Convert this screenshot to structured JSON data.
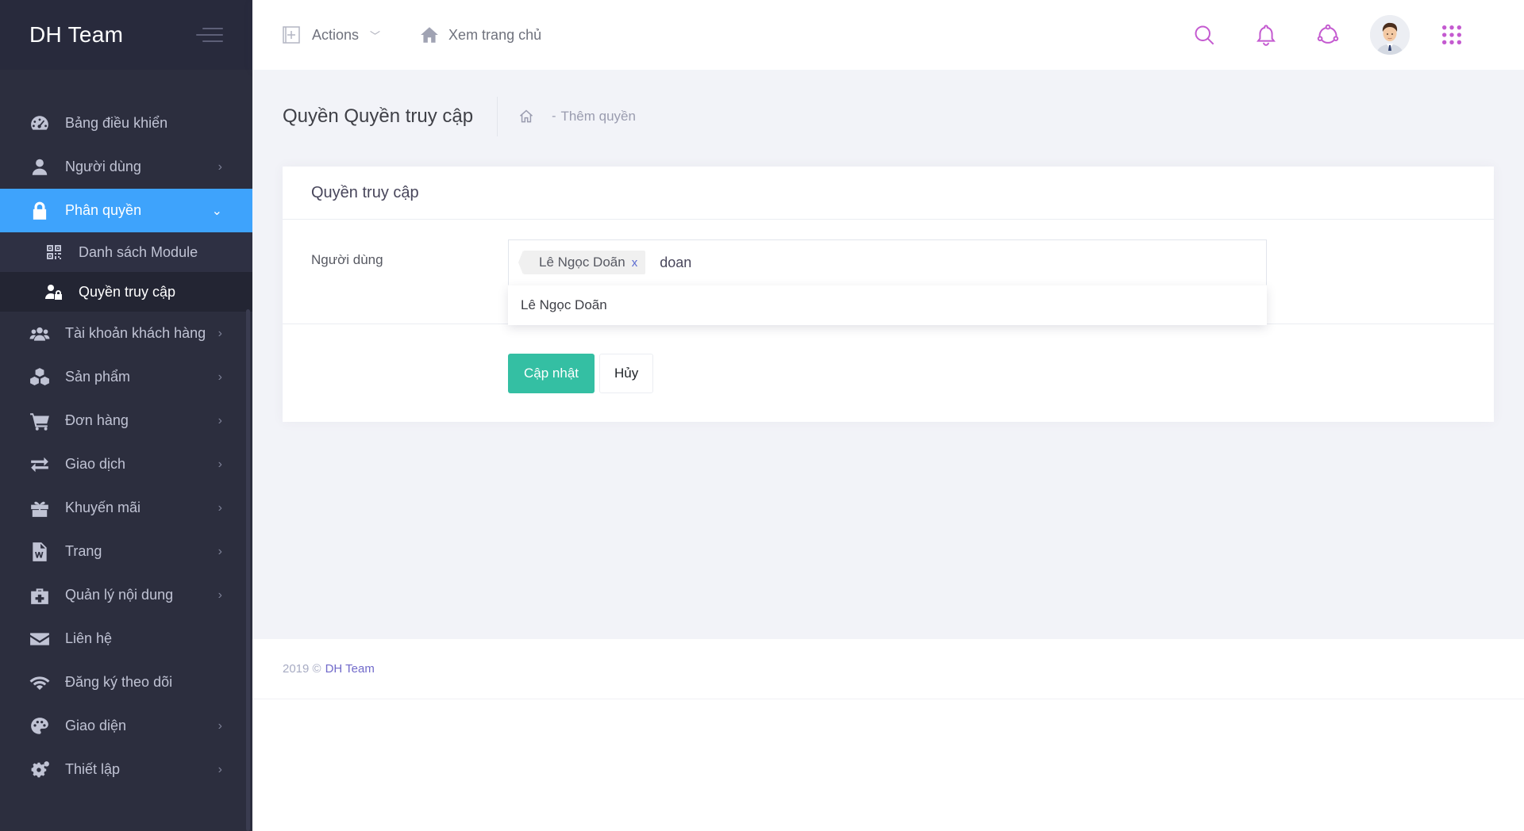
{
  "brand": {
    "name": "DH Team"
  },
  "header": {
    "actions_label": "Actions",
    "home_label": "Xem trang chủ"
  },
  "sidebar": {
    "items": [
      {
        "label": "Bảng điều khiển",
        "icon": "dashboard-icon",
        "has_children": false
      },
      {
        "label": "Người dùng",
        "icon": "user-icon",
        "has_children": true
      },
      {
        "label": "Phân quyền",
        "icon": "lock-icon",
        "has_children": true,
        "active": true,
        "children": [
          {
            "label": "Danh sách Module",
            "icon": "qrcode-icon"
          },
          {
            "label": "Quyền truy cập",
            "icon": "user-lock-icon",
            "current": true
          }
        ]
      },
      {
        "label": "Tài khoản khách hàng",
        "icon": "users-icon",
        "has_children": true
      },
      {
        "label": "Sản phẩm",
        "icon": "cubes-icon",
        "has_children": true
      },
      {
        "label": "Đơn hàng",
        "icon": "cart-icon",
        "has_children": true
      },
      {
        "label": "Giao dịch",
        "icon": "exchange-icon",
        "has_children": true
      },
      {
        "label": "Khuyến mãi",
        "icon": "gift-icon",
        "has_children": true
      },
      {
        "label": "Trang",
        "icon": "file-word-icon",
        "has_children": true
      },
      {
        "label": "Quản lý nội dung",
        "icon": "medkit-icon",
        "has_children": true
      },
      {
        "label": "Liên hệ",
        "icon": "envelope-icon",
        "has_children": false
      },
      {
        "label": "Đăng ký theo dõi",
        "icon": "wifi-icon",
        "has_children": false
      },
      {
        "label": "Giao diện",
        "icon": "palette-icon",
        "has_children": true
      },
      {
        "label": "Thiết lập",
        "icon": "cogs-icon",
        "has_children": true
      }
    ]
  },
  "subheader": {
    "title": "Quyền Quyền truy cập",
    "breadcrumb_separator": "-",
    "breadcrumb_link": "Thêm quyền"
  },
  "portlet": {
    "title": "Quyền truy cập",
    "field_label": "Người dùng",
    "selected_tag": "Lê Ngọc Doãn",
    "tag_remove": "x",
    "typed_value": "doan",
    "dropdown_option": "Lê Ngọc Doãn",
    "update_label": "Cập nhật",
    "cancel_label": "Hủy"
  },
  "footer": {
    "copyright": "2019 ©",
    "link_label": "DH Team"
  },
  "colors": {
    "sidebar_bg": "#2c2e3e",
    "active_item": "#3ea3fc",
    "accent_icons": "#c45ad0",
    "update_button": "#34bfa3",
    "footer_link": "#716aca"
  }
}
